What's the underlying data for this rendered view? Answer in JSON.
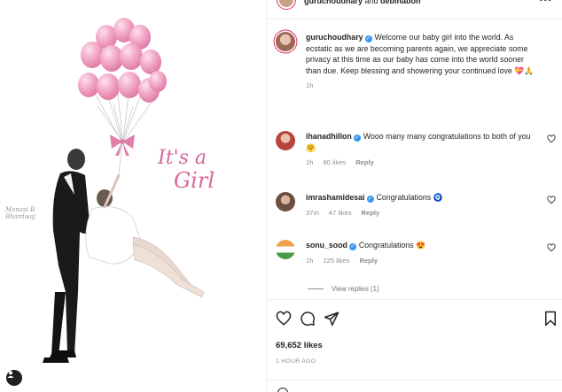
{
  "photo": {
    "caption_line1": "It's a",
    "caption_line2": "Girl",
    "signature": "Manasi B\nBhardwaj",
    "user_tag_icon": "user-tag-icon"
  },
  "header": {
    "text_user1": "guruchoudhary",
    "text_and": " and ",
    "text_user2": "debinabon",
    "more_icon": "more-options-icon"
  },
  "caption": {
    "username": "guruchoudhary",
    "text": "Welcome our baby girl into the world. As ecstatic as we are becoming parents again, we appreciate some privacy at this time as our baby has come into the world sooner than due. Keep blessing and showering your continued love",
    "emoji": "💝🙏",
    "time": "1h"
  },
  "comments": [
    {
      "username": "ihanadhillon",
      "text": "Wooo many many congratulations to both of you",
      "emoji": "🤗",
      "time": "1h",
      "likes": "80 likes",
      "reply": "Reply",
      "avatar_color": "#b8453b"
    },
    {
      "username": "imrashamidesai",
      "text": "Congratulations",
      "emoji": "🧿",
      "time": "37m",
      "likes": "47 likes",
      "reply": "Reply",
      "avatar_color": "#6b4f3f"
    },
    {
      "username": "sonu_sood",
      "text": "Congratulations",
      "emoji": "😍",
      "time": "1h",
      "likes": "225 likes",
      "reply": "Reply",
      "avatar_color": "#c0c7cf"
    }
  ],
  "view_replies": "View replies (1)",
  "actions": {
    "like_icon": "heart-icon",
    "comment_icon": "comment-icon",
    "share_icon": "share-icon",
    "save_icon": "bookmark-icon"
  },
  "likes_count": "69,652 likes",
  "posted_time": "1 HOUR AGO",
  "colors": {
    "verified": "#3897f0",
    "balloon_pink": "#f2a6c6",
    "caption_pink": "#d6679a",
    "muted_text": "#8e8e8e"
  }
}
